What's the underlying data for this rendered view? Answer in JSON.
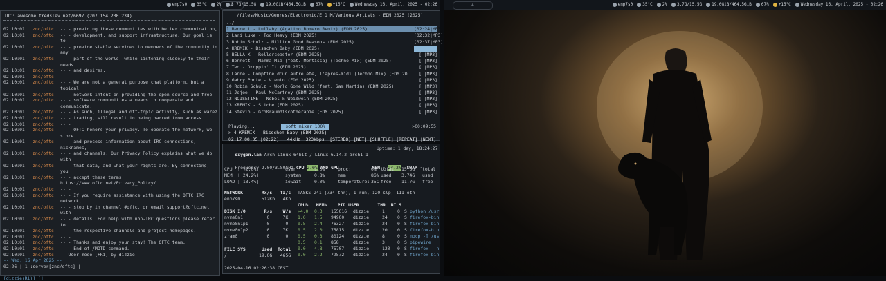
{
  "top_bar_left": {
    "workspace": "4",
    "items": [
      {
        "icon": "network-icon",
        "text": "enp7s0"
      },
      {
        "icon": "temperature-icon",
        "text": "35°C"
      },
      {
        "icon": "cpu-icon",
        "text": "2%"
      },
      {
        "icon": "memory-icon",
        "text": "3.7G/15.5G"
      },
      {
        "icon": "disk-icon",
        "text": "19.0GiB/464.5GiB"
      },
      {
        "icon": "volume-icon",
        "text": "67%"
      },
      {
        "icon": "weather-icon",
        "text": "+15°C"
      },
      {
        "icon": "clock-icon",
        "text": "Wednesday 16. April, 2025 - 02:26"
      }
    ]
  },
  "top_bar_right": {
    "workspace": "4",
    "items": [
      {
        "icon": "network-icon",
        "text": "enp7s0"
      },
      {
        "icon": "temperature-icon",
        "text": "35°C"
      },
      {
        "icon": "cpu-icon",
        "text": "2%"
      },
      {
        "icon": "memory-icon",
        "text": "3.7G/15.5G"
      },
      {
        "icon": "disk-icon",
        "text": "19.0GiB/464.5GiB"
      },
      {
        "icon": "volume-icon",
        "text": "67%"
      },
      {
        "icon": "weather-icon",
        "text": "+15°C"
      },
      {
        "icon": "clock-icon",
        "text": "Wednesday 16. April, 2025 - 02:26"
      }
    ]
  },
  "irc": {
    "title": "IRC: awesome.fredslev.net/6697 (207.154.230.234)",
    "lines": [
      {
        "ts": "02:10:01",
        "nick": "znc/oftc",
        "msg": "-- - providing these communities with better communication,"
      },
      {
        "ts": "02:10:01",
        "nick": "znc/oftc",
        "msg": "-- - development, and support infrastructure. Our goal is to"
      },
      {
        "ts": "02:10:01",
        "nick": "znc/oftc",
        "msg": "-- - provide stable services to members of the community in"
      },
      {
        "ts": "",
        "nick": "",
        "msg": "any"
      },
      {
        "ts": "02:10:01",
        "nick": "znc/oftc",
        "msg": "-- - part of the world, while listening closely to their"
      },
      {
        "ts": "",
        "nick": "",
        "msg": "needs"
      },
      {
        "ts": "02:10:01",
        "nick": "znc/oftc",
        "msg": "-- - and desires."
      },
      {
        "ts": "02:10:01",
        "nick": "znc/oftc",
        "msg": "-- -"
      },
      {
        "ts": "02:10:01",
        "nick": "znc/oftc",
        "msg": "-- - We are not a general purpose chat platform, but a"
      },
      {
        "ts": "",
        "nick": "",
        "msg": "topical"
      },
      {
        "ts": "02:10:01",
        "nick": "znc/oftc",
        "msg": "-- - network intent on providing the open source and free"
      },
      {
        "ts": "02:10:01",
        "nick": "znc/oftc",
        "msg": "-- - software communities a means to cooperate and"
      },
      {
        "ts": "",
        "nick": "",
        "msg": "communicate."
      },
      {
        "ts": "02:10:01",
        "nick": "znc/oftc",
        "msg": "-- - As such, illegal and off-topic activity, such as warez"
      },
      {
        "ts": "02:10:01",
        "nick": "znc/oftc",
        "msg": "-- - trading, will result in being barred from access."
      },
      {
        "ts": "02:10:01",
        "nick": "znc/oftc",
        "msg": "-- -"
      },
      {
        "ts": "02:10:01",
        "nick": "znc/oftc",
        "msg": "-- - OFTC honors your privacy. To operate the network, we"
      },
      {
        "ts": "",
        "nick": "",
        "msg": "store"
      },
      {
        "ts": "02:10:01",
        "nick": "znc/oftc",
        "msg": "-- - and process information about IRC connections,"
      },
      {
        "ts": "",
        "nick": "",
        "msg": "nicknames,"
      },
      {
        "ts": "02:10:01",
        "nick": "znc/oftc",
        "msg": "-- - and channels. Our Privacy Policy explains what we do"
      },
      {
        "ts": "",
        "nick": "",
        "msg": "with"
      },
      {
        "ts": "02:10:01",
        "nick": "znc/oftc",
        "msg": "-- - that data, and what your rights are. By connecting, you"
      },
      {
        "ts": "02:10:01",
        "nick": "znc/oftc",
        "msg": "-- - accept these terms: https://www.oftc.net/Privacy_Policy/"
      },
      {
        "ts": "02:10:01",
        "nick": "znc/oftc",
        "msg": "-- -"
      },
      {
        "ts": "02:10:01",
        "nick": "znc/oftc",
        "msg": "-- - If you require assistance with using the OFTC IRC"
      },
      {
        "ts": "",
        "nick": "",
        "msg": "network,"
      },
      {
        "ts": "02:10:01",
        "nick": "znc/oftc",
        "msg": "-- - stop by in channel #oftc, or email support@oftc.net with"
      },
      {
        "ts": "02:10:01",
        "nick": "znc/oftc",
        "msg": "-- - details. For help with non-IRC questions please refer to"
      },
      {
        "ts": "02:10:01",
        "nick": "znc/oftc",
        "msg": "-- - the respective channels and project homepages."
      },
      {
        "ts": "02:10:01",
        "nick": "znc/oftc",
        "msg": "-- -"
      },
      {
        "ts": "02:10:01",
        "nick": "znc/oftc",
        "msg": "-- - Thanks and enjoy your stay! The OFTC team."
      },
      {
        "ts": "02:10:01",
        "nick": "znc/oftc",
        "msg": "-- - End of /MOTD command."
      },
      {
        "ts": "02:10:01",
        "nick": "znc/oftc",
        "msg": "-- User mode [+Ri] by dizzie"
      }
    ],
    "day_change": "-- Wed, 16 Apr 2025 --",
    "status": "02:26 | 1 :server[znc/oftc] |",
    "input": "[dizzie(Ri)] []"
  },
  "player": {
    "path": "/files/Music/Genres/Electronic/E D M/Various Artists - EDM 2025 (2025)",
    "up": "../",
    "tracks": [
      {
        "name": "1 Bennett - Lullaby (Agatino Romero Remix) (EDM 2025)",
        "dur": "[02:24|MP3]"
      },
      {
        "name": "2 Lari Luke - Too Heavy (EDM 2025)",
        "dur": "[02:32|MP3]"
      },
      {
        "name": "3 Robin Schulz - Million Good Reasons (EDM 2025)",
        "dur": "[02:37|MP3]"
      },
      {
        "name": "4 KREMIK - Bisschen Baby (EDM 2025)",
        "dur": ""
      },
      {
        "name": "5 BELLA X - Rollercoaster (EDM 2025)",
        "dur": "[ |MP3]"
      },
      {
        "name": "6 Bennett - Mamma Mia (feat. Mentissa) (Techno Mix) (EDM 2025)",
        "dur": "[ |MP3]"
      },
      {
        "name": "7 Ted - Droppin' It (EDM 2025)",
        "dur": "[ |MP3]"
      },
      {
        "name": "8 Lanne - Comptine d'un autre été, l'après-midi (Techno Mix) (EDM 20",
        "dur": "[ |MP3]"
      },
      {
        "name": "9 Gabry Ponte - Viento (EDM 2025)",
        "dur": "[ |MP3]"
      },
      {
        "name": "10 Robin Schulz - World Gone Wild (feat. Sam Martin) (EDM 2025)",
        "dur": "[ |MP3]"
      },
      {
        "name": "11 Jojee - Paul McCartney (EDM 2025)",
        "dur": "[ |MP3]"
      },
      {
        "name": "12 NOISETIME - Nebel & Weißwein (EDM 2025)",
        "dur": "[ |MP3]"
      },
      {
        "name": "13 KREMIK - Stiche (EDM 2025)",
        "dur": "[ |MP3]"
      },
      {
        "name": "14 Stevio - Großraumdiscotherapie (EDM 2025)",
        "dur": "[ |MP3]"
      }
    ],
    "status_left": "Playing...",
    "mixer": "soft mixer 100%",
    "status_right": ">00:09:55",
    "now_playing": "> 4 KREMIK - Bisschen Baby (EDM 2025)",
    "time": "02:17 00:05 [02:22]",
    "rate": "44kHz",
    "bitrate": "323kbps",
    "flags": "[STEREO] [NET] [SHUFFLE] [REPEAT] [NEXT]"
  },
  "sysmon": {
    "host": "oxygen.lan",
    "os": "Arch Linux 64bit / Linux 6.14.2-arch1-1",
    "uptime": "Uptime: 1 day, 18:24:27",
    "freq": "Frequency 2.00/3.80GHz",
    "cpu_label": "CPU",
    "cpu_pct": "2.0%",
    "gpu_label": "AMD GPU",
    "mem_label": "MEM -",
    "mem_pct": "24.2%",
    "swap_label": "SWAP -",
    "swap_val": "-",
    "rows": [
      [
        "CPU  [  2.0%]",
        "user",
        "1.0%",
        "proc:",
        "0%",
        "total",
        "15.5G",
        "total"
      ],
      [
        "MEM  [ 24.2%]",
        "system",
        "0.8%",
        "mem:",
        "86%",
        "used",
        "3.74G",
        "used"
      ],
      [
        "LOAD [ 13.4%]",
        "iowait",
        "0.0%",
        "temperature:",
        "35C",
        "free",
        "11.7G",
        "free"
      ]
    ],
    "net_header": "NETWORK       Rx/s   Tx/s",
    "net_row": "enp7s0        512Kb   4Kb",
    "tasks": "TASKS 241 (734 thr), 1 run, 120 slp, 111 oth",
    "disk_header": "DISK I/O       R/s    W/s",
    "disks": [
      "nvme0n1         0     7K",
      "nvme0n1p1       0      0",
      "nvme0n1p2       0     7K",
      "zram0           0      0"
    ],
    "fs_header": "FILE SYS      Used  Total",
    "fs_row": "/            19.0G   465G",
    "proc_header": "CPU%   MEM%    PID USER       THR  NI S",
    "procs": [
      [
        ">4.0",
        "0.3",
        "155016",
        "dizzie",
        "1",
        "0",
        "S",
        "python /usr"
      ],
      [
        "1.0",
        "1.5",
        "94900",
        "dizzie",
        "24",
        "0",
        "S",
        "firefox-bin"
      ],
      [
        "0.5",
        "2.4",
        "76327",
        "dizzie",
        "24",
        "0",
        "S",
        "firefox-bin"
      ],
      [
        "0.5",
        "2.0",
        "75815",
        "dizzie",
        "20",
        "0",
        "S",
        "firefox-bin"
      ],
      [
        "0.5",
        "0.3",
        "80124",
        "dizzie",
        "8",
        "0",
        "S",
        "mocp -T /us"
      ],
      [
        "0.5",
        "0.1",
        "858",
        "dizzie",
        "3",
        "0",
        "S",
        "pipewire"
      ],
      [
        "0.0",
        "4.8",
        "75707",
        "dizzie",
        "120",
        "0",
        "S",
        "firefox --n"
      ],
      [
        "0.0",
        "2.2",
        "79572",
        "dizzie",
        "24",
        "0",
        "S",
        "firefox-bin"
      ]
    ],
    "date": "2025-04-16 02:26:38 CEST"
  }
}
